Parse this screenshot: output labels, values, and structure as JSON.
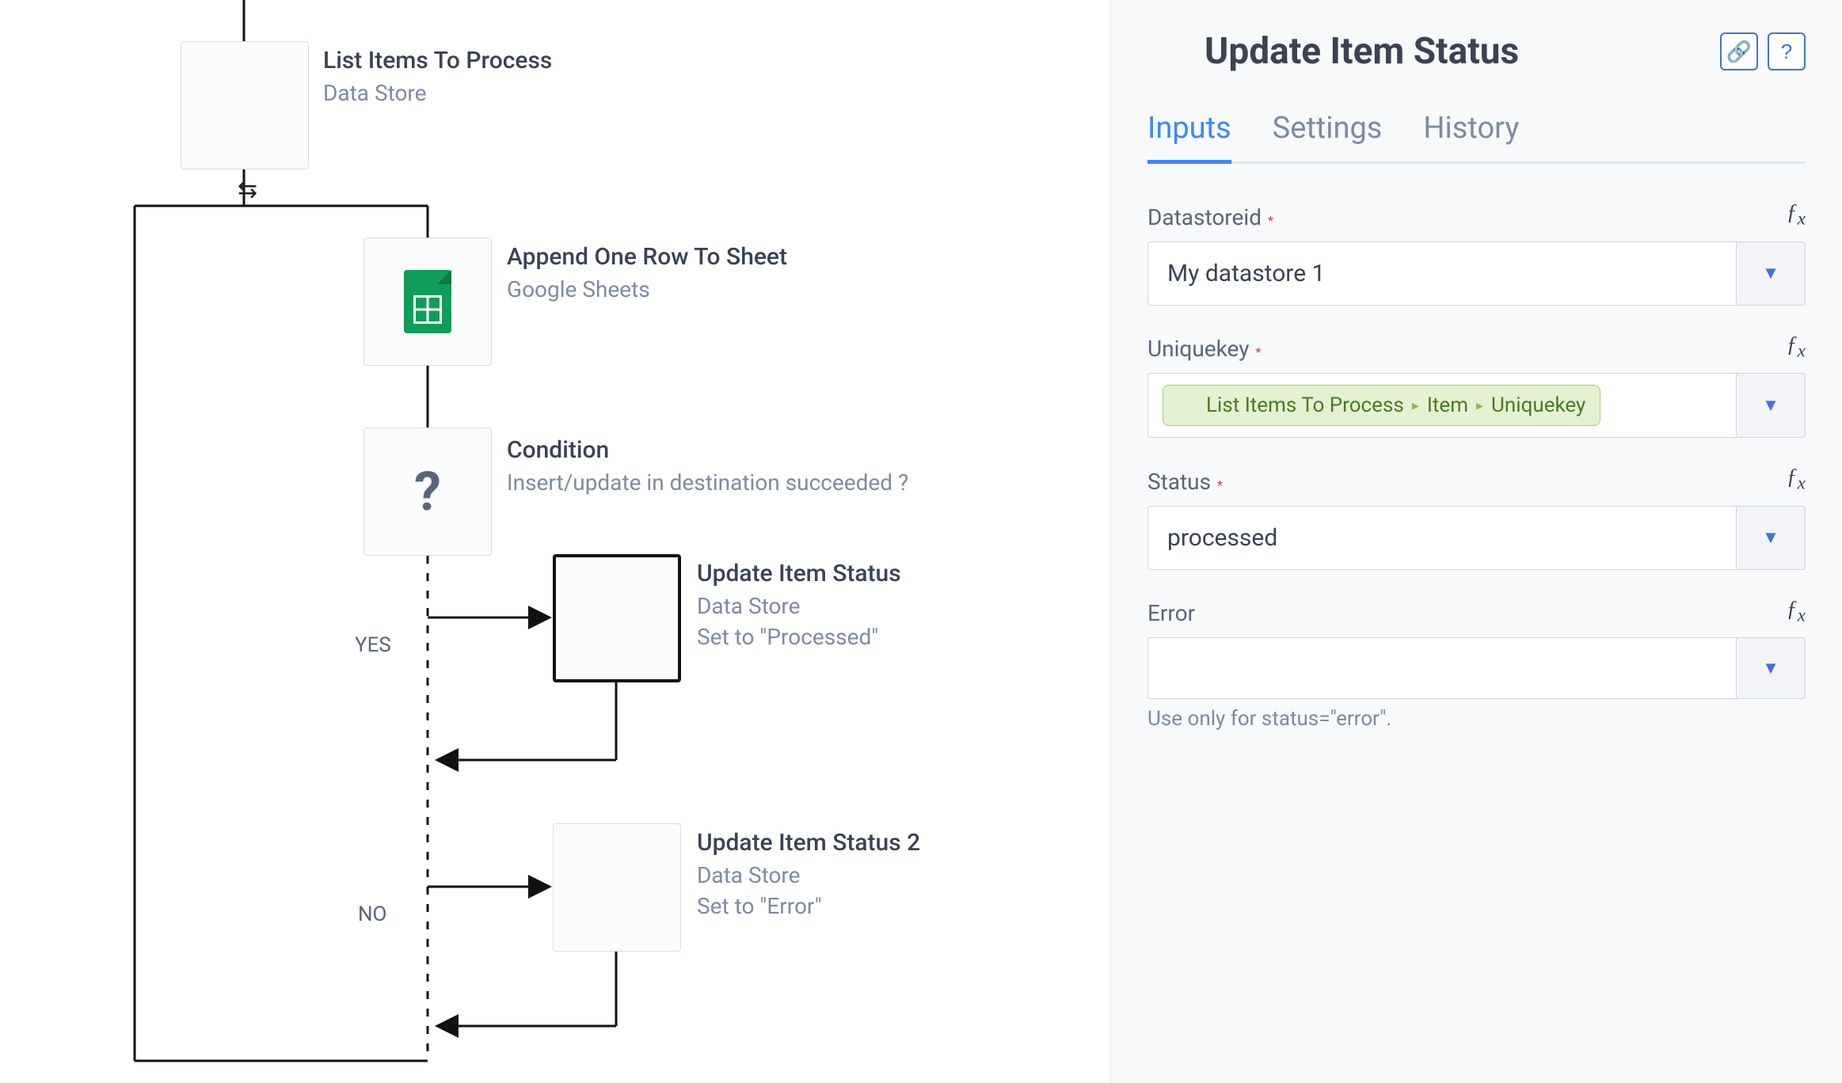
{
  "canvas": {
    "nodes": {
      "list_items": {
        "title": "List Items To Process",
        "subtitle": "Data Store"
      },
      "append": {
        "title": "Append One Row To Sheet",
        "subtitle": "Google Sheets"
      },
      "condition": {
        "title": "Condition",
        "subtitle": "Insert/update in destination succeeded ?"
      },
      "update_ok": {
        "title": "Update Item Status",
        "subtitle1": "Data Store",
        "subtitle2": "Set to \"Processed\""
      },
      "update_err": {
        "title": "Update Item Status 2",
        "subtitle1": "Data Store",
        "subtitle2": "Set to \"Error\""
      }
    },
    "branches": {
      "yes": "YES",
      "no": "NO"
    }
  },
  "panel": {
    "title": "Update Item Status",
    "tabs": {
      "inputs": "Inputs",
      "settings": "Settings",
      "history": "History"
    },
    "fields": {
      "datastoreid": {
        "label": "Datastoreid",
        "value": "My datastore 1"
      },
      "uniquekey": {
        "label": "Uniquekey",
        "pill": {
          "a": "List Items To Process",
          "b": "Item",
          "c": "Uniquekey"
        }
      },
      "status": {
        "label": "Status",
        "value": "processed"
      },
      "error": {
        "label": "Error",
        "value": "",
        "hint": "Use only for status=\"error\"."
      }
    }
  }
}
